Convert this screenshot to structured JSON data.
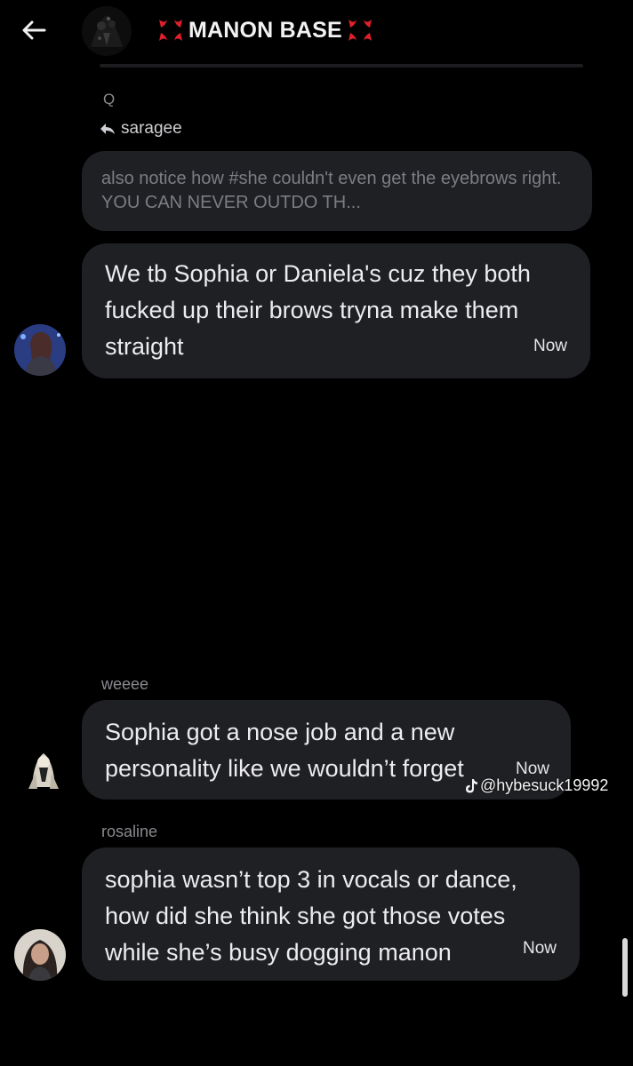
{
  "header": {
    "title": "MANON BASE",
    "emoji_left": "anger-symbol",
    "emoji_right": "anger-symbol"
  },
  "reply_context": {
    "q_label": "Q",
    "reply_to_name": "saragee",
    "quoted_text": "also notice how #she couldn't even get the eyebrows right. YOU CAN NEVER OUTDO TH..."
  },
  "messages": [
    {
      "sender": "",
      "lines": [
        "We tb Sophia or Daniela's cuz they both",
        "fucked up their brows tryna make them",
        "straight"
      ],
      "time": "Now"
    },
    {
      "sender": "weeee",
      "lines": [
        "Sophia got a nose job and a new",
        "personality like we wouldn’t forget"
      ],
      "time": "Now"
    },
    {
      "sender": "rosaline",
      "lines": [
        "sophia wasn’t top 3 in vocals or dance,",
        "how did she think she got those votes",
        "while she’s busy dogging manon"
      ],
      "time": "Now"
    }
  ],
  "watermark": {
    "icon": "tiktok-icon",
    "text": "@hybesuck19992"
  },
  "colors": {
    "background": "#000000",
    "bubble": "#1f2024",
    "muted_text": "#8a8a90",
    "anger_red": "#e0202a"
  }
}
